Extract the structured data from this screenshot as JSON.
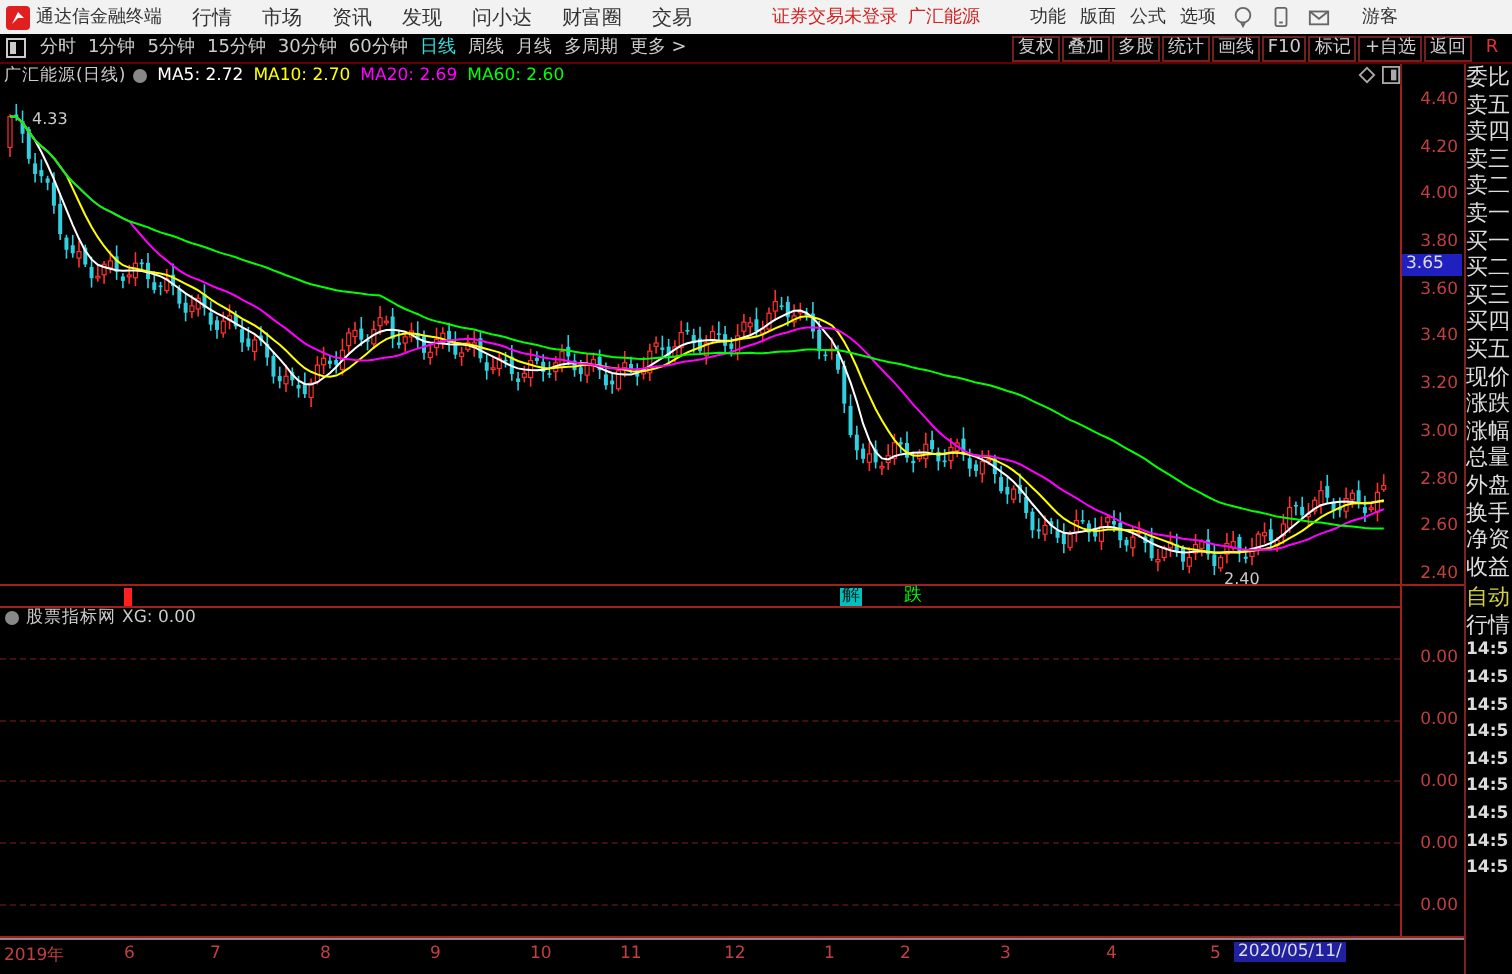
{
  "menu_bar": {
    "app_title": "通达信金融终端",
    "menus": [
      "行情",
      "市场",
      "资讯",
      "发现",
      "问小达",
      "财富圈",
      "交易"
    ],
    "login_status": "证券交易未登录",
    "stock_name": "广汇能源",
    "right_menus": [
      "功能",
      "版面",
      "公式",
      "选项"
    ],
    "user": "游客"
  },
  "period_tabs": [
    {
      "label": "分时",
      "selected": false
    },
    {
      "label": "1分钟",
      "selected": false
    },
    {
      "label": "5分钟",
      "selected": false
    },
    {
      "label": "15分钟",
      "selected": false
    },
    {
      "label": "30分钟",
      "selected": false
    },
    {
      "label": "60分钟",
      "selected": false
    },
    {
      "label": "日线",
      "selected": true
    },
    {
      "label": "周线",
      "selected": false
    },
    {
      "label": "月线",
      "selected": false
    },
    {
      "label": "多周期",
      "selected": false
    },
    {
      "label": "更多 >",
      "selected": false
    }
  ],
  "tools": [
    "复权",
    "叠加",
    "多股",
    "统计",
    "画线",
    "F10",
    "标记",
    "+自选",
    "返回"
  ],
  "corner_label": "R",
  "chart_header": {
    "title": "广汇能源(日线)",
    "indicators": [
      {
        "label": "MA5: 2.72",
        "color": "#ffffff"
      },
      {
        "label": "MA10: 2.70",
        "color": "#ffff00"
      },
      {
        "label": "MA20: 2.69",
        "color": "#ff00ff"
      },
      {
        "label": "MA60: 2.60",
        "color": "#00ff00"
      }
    ]
  },
  "price_axis": [
    "4.40",
    "4.20",
    "4.00",
    "3.80",
    "3.60",
    "3.40",
    "3.20",
    "3.00",
    "2.80",
    "2.60",
    "2.40"
  ],
  "price_cursor": "3.65",
  "annotations": {
    "high": "4.33",
    "low": "2.40"
  },
  "signals": [
    {
      "kind": "mark",
      "color": "#ff2020"
    },
    {
      "kind": "boxed",
      "label": "解",
      "color": "#00c0c0"
    },
    {
      "kind": "text",
      "label": "跌",
      "color": "#00ff00"
    }
  ],
  "indicator": {
    "title": "股票指标网",
    "formula": "XG: 0.00",
    "axis": [
      "0.00",
      "0.00",
      "0.00",
      "0.00",
      "0.00"
    ]
  },
  "side_panel": {
    "quote_labels": [
      "委比",
      "卖五",
      "卖四",
      "卖三",
      "卖二",
      "卖一",
      "买一",
      "买二",
      "买三",
      "买四",
      "买五",
      "现价",
      "涨跌",
      "涨幅",
      "总量",
      "外盘",
      "换手",
      "净资",
      "收益"
    ],
    "auto_label": "自动",
    "section": "行情",
    "times": [
      "14:5",
      "14:5",
      "14:5",
      "14:5",
      "14:5",
      "14:5",
      "14:5",
      "14:5",
      "14:5"
    ]
  },
  "date_axis": {
    "labels": [
      "2019年",
      "6",
      "7",
      "8",
      "9",
      "10",
      "11",
      "12",
      "1",
      "2",
      "3",
      "4",
      "5"
    ],
    "cursor_date": "2020/05/11/"
  }
}
